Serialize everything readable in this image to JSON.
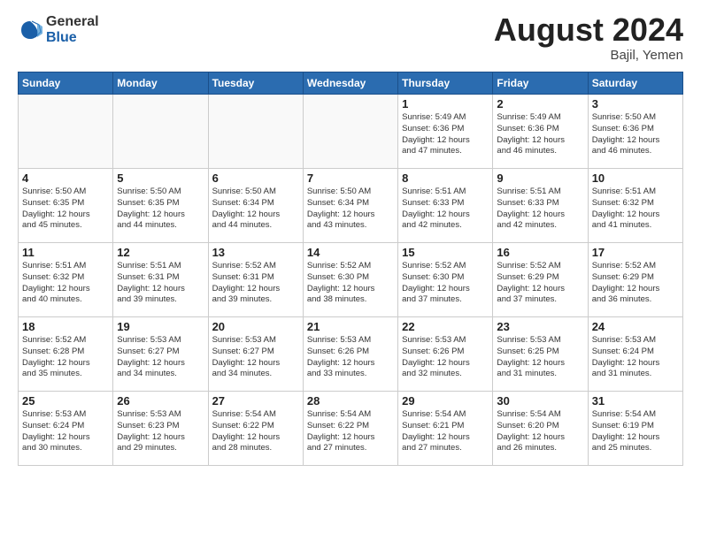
{
  "header": {
    "logo_line1": "General",
    "logo_line2": "Blue",
    "month_year": "August 2024",
    "location": "Bajil, Yemen"
  },
  "weekdays": [
    "Sunday",
    "Monday",
    "Tuesday",
    "Wednesday",
    "Thursday",
    "Friday",
    "Saturday"
  ],
  "weeks": [
    [
      {
        "day": "",
        "info": ""
      },
      {
        "day": "",
        "info": ""
      },
      {
        "day": "",
        "info": ""
      },
      {
        "day": "",
        "info": ""
      },
      {
        "day": "1",
        "info": "Sunrise: 5:49 AM\nSunset: 6:36 PM\nDaylight: 12 hours\nand 47 minutes."
      },
      {
        "day": "2",
        "info": "Sunrise: 5:49 AM\nSunset: 6:36 PM\nDaylight: 12 hours\nand 46 minutes."
      },
      {
        "day": "3",
        "info": "Sunrise: 5:50 AM\nSunset: 6:36 PM\nDaylight: 12 hours\nand 46 minutes."
      }
    ],
    [
      {
        "day": "4",
        "info": "Sunrise: 5:50 AM\nSunset: 6:35 PM\nDaylight: 12 hours\nand 45 minutes."
      },
      {
        "day": "5",
        "info": "Sunrise: 5:50 AM\nSunset: 6:35 PM\nDaylight: 12 hours\nand 44 minutes."
      },
      {
        "day": "6",
        "info": "Sunrise: 5:50 AM\nSunset: 6:34 PM\nDaylight: 12 hours\nand 44 minutes."
      },
      {
        "day": "7",
        "info": "Sunrise: 5:50 AM\nSunset: 6:34 PM\nDaylight: 12 hours\nand 43 minutes."
      },
      {
        "day": "8",
        "info": "Sunrise: 5:51 AM\nSunset: 6:33 PM\nDaylight: 12 hours\nand 42 minutes."
      },
      {
        "day": "9",
        "info": "Sunrise: 5:51 AM\nSunset: 6:33 PM\nDaylight: 12 hours\nand 42 minutes."
      },
      {
        "day": "10",
        "info": "Sunrise: 5:51 AM\nSunset: 6:32 PM\nDaylight: 12 hours\nand 41 minutes."
      }
    ],
    [
      {
        "day": "11",
        "info": "Sunrise: 5:51 AM\nSunset: 6:32 PM\nDaylight: 12 hours\nand 40 minutes."
      },
      {
        "day": "12",
        "info": "Sunrise: 5:51 AM\nSunset: 6:31 PM\nDaylight: 12 hours\nand 39 minutes."
      },
      {
        "day": "13",
        "info": "Sunrise: 5:52 AM\nSunset: 6:31 PM\nDaylight: 12 hours\nand 39 minutes."
      },
      {
        "day": "14",
        "info": "Sunrise: 5:52 AM\nSunset: 6:30 PM\nDaylight: 12 hours\nand 38 minutes."
      },
      {
        "day": "15",
        "info": "Sunrise: 5:52 AM\nSunset: 6:30 PM\nDaylight: 12 hours\nand 37 minutes."
      },
      {
        "day": "16",
        "info": "Sunrise: 5:52 AM\nSunset: 6:29 PM\nDaylight: 12 hours\nand 37 minutes."
      },
      {
        "day": "17",
        "info": "Sunrise: 5:52 AM\nSunset: 6:29 PM\nDaylight: 12 hours\nand 36 minutes."
      }
    ],
    [
      {
        "day": "18",
        "info": "Sunrise: 5:52 AM\nSunset: 6:28 PM\nDaylight: 12 hours\nand 35 minutes."
      },
      {
        "day": "19",
        "info": "Sunrise: 5:53 AM\nSunset: 6:27 PM\nDaylight: 12 hours\nand 34 minutes."
      },
      {
        "day": "20",
        "info": "Sunrise: 5:53 AM\nSunset: 6:27 PM\nDaylight: 12 hours\nand 34 minutes."
      },
      {
        "day": "21",
        "info": "Sunrise: 5:53 AM\nSunset: 6:26 PM\nDaylight: 12 hours\nand 33 minutes."
      },
      {
        "day": "22",
        "info": "Sunrise: 5:53 AM\nSunset: 6:26 PM\nDaylight: 12 hours\nand 32 minutes."
      },
      {
        "day": "23",
        "info": "Sunrise: 5:53 AM\nSunset: 6:25 PM\nDaylight: 12 hours\nand 31 minutes."
      },
      {
        "day": "24",
        "info": "Sunrise: 5:53 AM\nSunset: 6:24 PM\nDaylight: 12 hours\nand 31 minutes."
      }
    ],
    [
      {
        "day": "25",
        "info": "Sunrise: 5:53 AM\nSunset: 6:24 PM\nDaylight: 12 hours\nand 30 minutes."
      },
      {
        "day": "26",
        "info": "Sunrise: 5:53 AM\nSunset: 6:23 PM\nDaylight: 12 hours\nand 29 minutes."
      },
      {
        "day": "27",
        "info": "Sunrise: 5:54 AM\nSunset: 6:22 PM\nDaylight: 12 hours\nand 28 minutes."
      },
      {
        "day": "28",
        "info": "Sunrise: 5:54 AM\nSunset: 6:22 PM\nDaylight: 12 hours\nand 27 minutes."
      },
      {
        "day": "29",
        "info": "Sunrise: 5:54 AM\nSunset: 6:21 PM\nDaylight: 12 hours\nand 27 minutes."
      },
      {
        "day": "30",
        "info": "Sunrise: 5:54 AM\nSunset: 6:20 PM\nDaylight: 12 hours\nand 26 minutes."
      },
      {
        "day": "31",
        "info": "Sunrise: 5:54 AM\nSunset: 6:19 PM\nDaylight: 12 hours\nand 25 minutes."
      }
    ]
  ]
}
